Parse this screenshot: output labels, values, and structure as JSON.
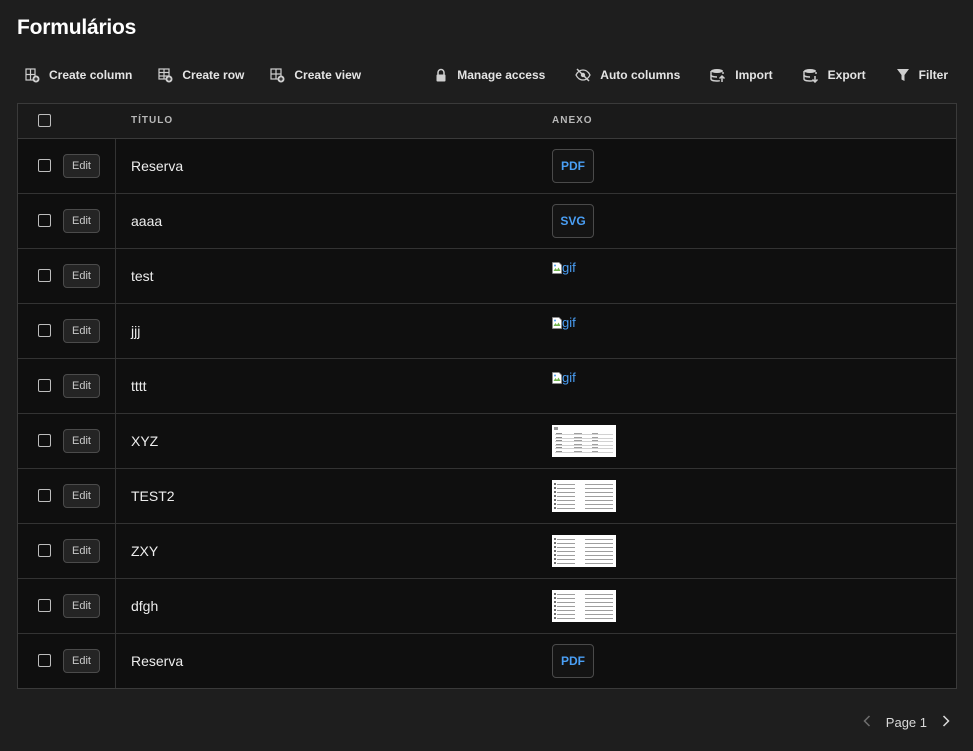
{
  "page": {
    "title": "Formulários"
  },
  "toolbar": {
    "left": [
      {
        "label": "Create column",
        "icon": "create-column-icon"
      },
      {
        "label": "Create row",
        "icon": "create-row-icon"
      },
      {
        "label": "Create view",
        "icon": "create-view-icon"
      }
    ],
    "right": [
      {
        "label": "Manage access",
        "icon": "lock-icon"
      },
      {
        "label": "Auto columns",
        "icon": "eye-off-icon"
      },
      {
        "label": "Import",
        "icon": "import-icon"
      },
      {
        "label": "Export",
        "icon": "export-icon"
      },
      {
        "label": "Filter",
        "icon": "filter-icon"
      }
    ]
  },
  "table": {
    "columns": [
      "TÍTULO",
      "ANEXO"
    ],
    "edit_label": "Edit",
    "rows": [
      {
        "titulo": "Reserva",
        "anexo_type": "badge",
        "anexo_text": "PDF"
      },
      {
        "titulo": "aaaa",
        "anexo_type": "badge",
        "anexo_text": "SVG"
      },
      {
        "titulo": "test",
        "anexo_type": "broken",
        "anexo_text": "gif"
      },
      {
        "titulo": "jjj",
        "anexo_type": "broken",
        "anexo_text": "gif"
      },
      {
        "titulo": "tttt",
        "anexo_type": "broken",
        "anexo_text": "gif"
      },
      {
        "titulo": "XYZ",
        "anexo_type": "thumb-table"
      },
      {
        "titulo": "TEST2",
        "anexo_type": "thumb-list"
      },
      {
        "titulo": "ZXY",
        "anexo_type": "thumb-list"
      },
      {
        "titulo": "dfgh",
        "anexo_type": "thumb-list"
      },
      {
        "titulo": "Reserva",
        "anexo_type": "badge",
        "anexo_text": "PDF"
      }
    ]
  },
  "pagination": {
    "label": "Page 1"
  },
  "colors": {
    "background": "#1e1e1e",
    "table_background": "#0f0f0f",
    "link_accent": "#4a9ff5"
  }
}
